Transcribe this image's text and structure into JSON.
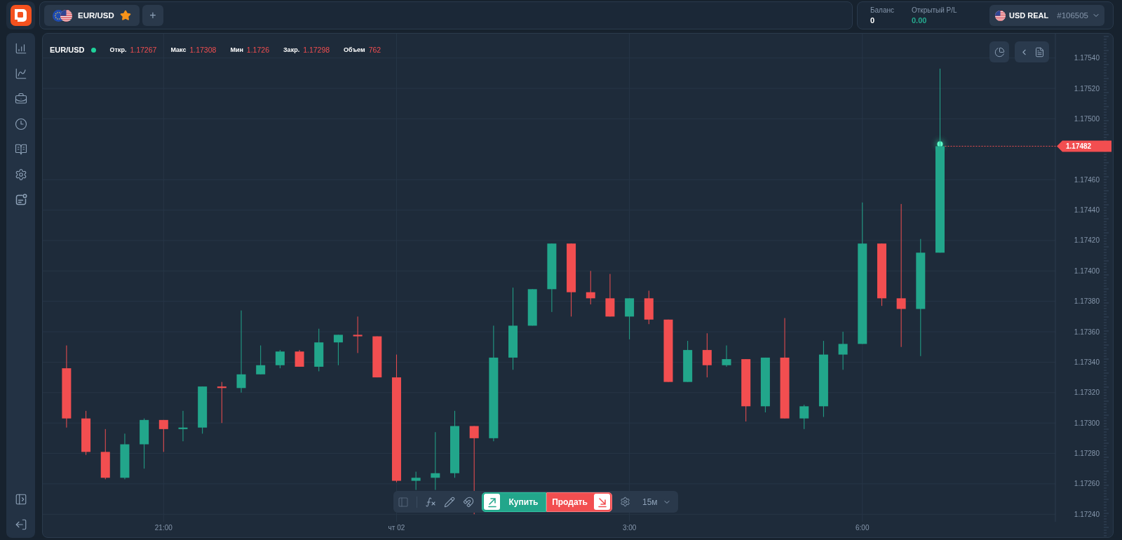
{
  "header": {
    "tab": {
      "symbol": "EUR/USD",
      "favorite": true,
      "selected": true
    },
    "add_tab": "+",
    "balance": {
      "label": "Баланс",
      "value": "0"
    },
    "open_pl": {
      "label": "Открытый P/L",
      "value": "0.00"
    },
    "account": {
      "name": "USD REAL",
      "number": "#106505"
    }
  },
  "chart": {
    "symbol": "EUR/USD",
    "live": true,
    "stats": [
      {
        "label": "Откр.",
        "value": "1.17267"
      },
      {
        "label": "Макс",
        "value": "1.17308"
      },
      {
        "label": "Мин",
        "value": "1.1726"
      },
      {
        "label": "Закр.",
        "value": "1.17298"
      },
      {
        "label": "Объем",
        "value": "762"
      }
    ],
    "last_price": "1.17482",
    "chart_data": {
      "type": "candlestick",
      "grid": true,
      "categories": [
        null,
        null,
        null,
        null,
        null,
        "21:00",
        null,
        null,
        null,
        null,
        null,
        null,
        null,
        null,
        null,
        null,
        null,
        "чт 02",
        null,
        null,
        null,
        null,
        null,
        null,
        null,
        null,
        null,
        null,
        null,
        "3:00",
        null,
        null,
        null,
        null,
        null,
        null,
        null,
        null,
        null,
        null,
        null,
        "6:00",
        null,
        null,
        null,
        null,
        null,
        null,
        null,
        null,
        null
      ],
      "ohlc": [
        [
          1.17336,
          1.17351,
          1.17297,
          1.17303
        ],
        [
          1.17303,
          1.17308,
          1.17279,
          1.17281
        ],
        [
          1.17281,
          1.17296,
          1.17263,
          1.17264
        ],
        [
          1.17264,
          1.17293,
          1.17263,
          1.17286
        ],
        [
          1.17286,
          1.17303,
          1.1727,
          1.17302
        ],
        [
          1.17302,
          1.17302,
          1.17281,
          1.17296
        ],
        [
          1.17296,
          1.17308,
          1.17288,
          1.17297
        ],
        [
          1.17297,
          1.17324,
          1.17293,
          1.17324
        ],
        [
          1.17324,
          1.17327,
          1.173,
          1.17323
        ],
        [
          1.17323,
          1.17374,
          1.1732,
          1.17332
        ],
        [
          1.17332,
          1.17351,
          1.17332,
          1.17338
        ],
        [
          1.17338,
          1.17348,
          1.17336,
          1.17347
        ],
        [
          1.17347,
          1.17348,
          1.17337,
          1.17337
        ],
        [
          1.17337,
          1.17362,
          1.17334,
          1.17353
        ],
        [
          1.17353,
          1.17358,
          1.17338,
          1.17358
        ],
        [
          1.17358,
          1.1737,
          1.17346,
          1.17357
        ],
        [
          1.17357,
          1.17357,
          1.1733,
          1.1733
        ],
        [
          1.1733,
          1.17345,
          1.17261,
          1.17262
        ],
        [
          1.17262,
          1.17268,
          1.17256,
          1.17264
        ],
        [
          1.17264,
          1.17294,
          1.17256,
          1.17267
        ],
        [
          1.17267,
          1.17308,
          1.17264,
          1.17298
        ],
        [
          1.17298,
          1.17298,
          1.1724,
          1.1729
        ],
        [
          1.1729,
          1.17364,
          1.17288,
          1.17343
        ],
        [
          1.17343,
          1.17389,
          1.17335,
          1.17364
        ],
        [
          1.17364,
          1.17388,
          1.17364,
          1.17388
        ],
        [
          1.17388,
          1.17418,
          1.17373,
          1.17418
        ],
        [
          1.17418,
          1.17418,
          1.1737,
          1.17386
        ],
        [
          1.17386,
          1.174,
          1.17378,
          1.17382
        ],
        [
          1.17382,
          1.17398,
          1.1737,
          1.1737
        ],
        [
          1.1737,
          1.17382,
          1.17355,
          1.17382
        ],
        [
          1.17382,
          1.17387,
          1.17365,
          1.17368
        ],
        [
          1.17368,
          1.17368,
          1.17327,
          1.17327
        ],
        [
          1.17327,
          1.17354,
          1.17327,
          1.17348
        ],
        [
          1.17348,
          1.17359,
          1.1733,
          1.17338
        ],
        [
          1.17338,
          1.17351,
          1.17337,
          1.17342
        ],
        [
          1.17342,
          1.17342,
          1.17301,
          1.17311
        ],
        [
          1.17311,
          1.17343,
          1.17307,
          1.17343
        ],
        [
          1.17343,
          1.17369,
          1.17303,
          1.17303
        ],
        [
          1.17303,
          1.17312,
          1.17296,
          1.17311
        ],
        [
          1.17311,
          1.17354,
          1.17304,
          1.17345
        ],
        [
          1.17345,
          1.1736,
          1.17335,
          1.17352
        ],
        [
          1.17352,
          1.17445,
          1.17352,
          1.17418
        ],
        [
          1.17418,
          1.17418,
          1.17377,
          1.17382
        ],
        [
          1.17382,
          1.17444,
          1.1735,
          1.17375
        ],
        [
          1.17375,
          1.17421,
          1.17344,
          1.17412
        ],
        [
          1.17412,
          1.17533,
          1.17412,
          1.17482
        ],
        null,
        null,
        null,
        null,
        null
      ],
      "ylim": [
        1.1724,
        1.1754
      ],
      "yticks": [
        {
          "value": 1.1724,
          "label": "1.17240"
        },
        {
          "value": 1.1726,
          "label": "1.17260"
        },
        {
          "value": 1.1728,
          "label": "1.17280"
        },
        {
          "value": 1.173,
          "label": "1.17300"
        },
        {
          "value": 1.1732,
          "label": "1.17320"
        },
        {
          "value": 1.1734,
          "label": "1.17340"
        },
        {
          "value": 1.1736,
          "label": "1.17360"
        },
        {
          "value": 1.1738,
          "label": "1.17380"
        },
        {
          "value": 1.174,
          "label": "1.17400"
        },
        {
          "value": 1.1742,
          "label": "1.17420"
        },
        {
          "value": 1.1744,
          "label": "1.17440"
        },
        {
          "value": 1.1746,
          "label": "1.17460"
        },
        {
          "value": 1.175,
          "label": "1.17500"
        },
        {
          "value": 1.1752,
          "label": "1.17520"
        },
        {
          "value": 1.1754,
          "label": "1.17540"
        }
      ]
    }
  },
  "toolbar": {
    "tools": [
      {
        "disabled": true
      },
      {
        "disabled": false
      },
      {
        "disabled": false
      },
      {
        "disabled": false
      }
    ],
    "trade": [
      {
        "kind": "buy",
        "label": "Купить"
      },
      {
        "kind": "sell",
        "label": "Продать"
      }
    ],
    "timeframe": "15м"
  }
}
